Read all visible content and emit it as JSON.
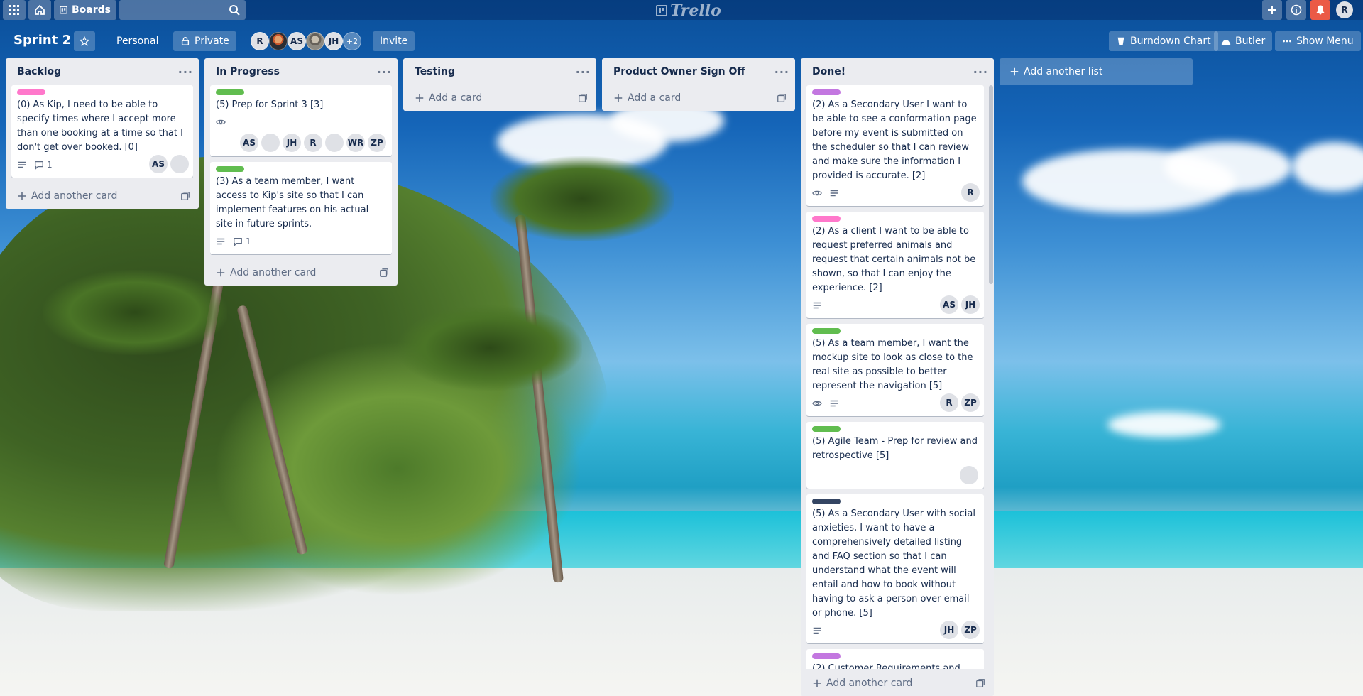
{
  "topbar": {
    "boards_label": "Boards",
    "logo_text": "Trello",
    "user_initial": "R"
  },
  "board": {
    "title": "Sprint 2",
    "team_label": "Personal",
    "visibility_label": "Private",
    "members": [
      "R",
      "AS",
      "JH"
    ],
    "more_members": "+2",
    "invite_label": "Invite",
    "burndown_label": "Burndown Chart",
    "butler_label": "Butler",
    "menu_label": "Show Menu"
  },
  "lists": {
    "backlog": {
      "title": "Backlog",
      "cards": [
        {
          "label_color": "#ff78cb",
          "title": "(0) As Kip, I need to be able to specify times where I accept more than one booking at a time so that I don't get over booked. [0]",
          "comments": "1",
          "members": [
            "AS"
          ]
        }
      ],
      "add_label": "Add another card"
    },
    "in_progress": {
      "title": "In Progress",
      "cards": [
        {
          "label_color": "#61bd4f",
          "title": "(5) Prep for Sprint 3 [3]",
          "members": [
            "AS",
            "JH",
            "R",
            "WR",
            "ZP"
          ]
        },
        {
          "label_color": "#61bd4f",
          "title": "(3) As a team member, I want access to Kip's site so that I can implement features on his actual site in future sprints.",
          "comments": "1"
        }
      ],
      "add_label": "Add another card"
    },
    "testing": {
      "title": "Testing",
      "add_label": "Add a card"
    },
    "po_signoff": {
      "title": "Product Owner Sign Off",
      "add_label": "Add a card"
    },
    "done": {
      "title": "Done!",
      "cards": [
        {
          "label_color": "#c377e0",
          "title": "(2) As a Secondary User I want to be able to see a conformation page before my event is submitted on the scheduler so that I can review and make sure the information I provided is accurate. [2]",
          "members": [
            "R"
          ]
        },
        {
          "label_color": "#ff78cb",
          "title": "(2) As a client I want to be able to request preferred animals and request that certain animals not be shown, so that I can enjoy the experience. [2]",
          "members": [
            "AS",
            "JH"
          ]
        },
        {
          "label_color": "#61bd4f",
          "title": "(5) As a team member, I want the mockup site to look as close to the real site as possible to better represent the navigation [5]",
          "members": [
            "R",
            "ZP"
          ]
        },
        {
          "label_color": "#61bd4f",
          "title": "(5) Agile Team - Prep for review and retrospective [5]"
        },
        {
          "label_color": "#344563",
          "title": "(5) As a Secondary User with social anxieties, I want to have a comprehensively detailed listing and FAQ section so that I can understand what the event will entail and how to book without having to ask a person over email or phone. [5]",
          "members": [
            "JH",
            "ZP"
          ]
        },
        {
          "label_color": "#c377e0",
          "title": "(2) Customer Requirements and"
        }
      ],
      "add_label": "Add another card"
    }
  },
  "add_list_label": "Add another list"
}
